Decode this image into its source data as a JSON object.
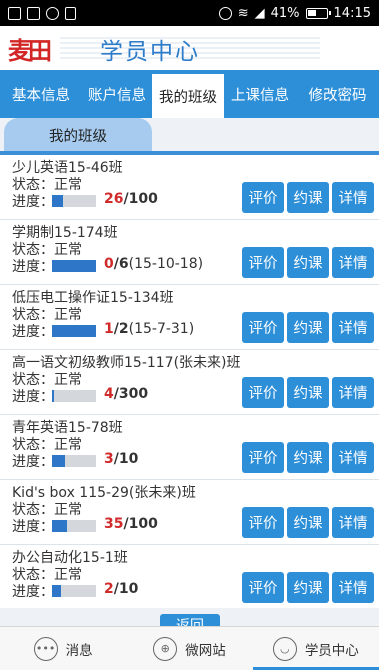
{
  "status_bar": {
    "battery": "41%",
    "time": "14:15"
  },
  "header": {
    "logo_text": "麦田",
    "title": "学员中心"
  },
  "tabs": [
    {
      "label": "基本信息"
    },
    {
      "label": "账户信息"
    },
    {
      "label": "我的班级"
    },
    {
      "label": "上课信息"
    },
    {
      "label": "修改密码"
    }
  ],
  "section": {
    "title": "我的班级"
  },
  "labels": {
    "status_prefix": "状态：",
    "progress_prefix": "进度：",
    "rate": "评价",
    "book": "约课",
    "detail": "详情"
  },
  "classes": [
    {
      "name": "少儿英语15-46班",
      "status": "正常",
      "done": "26",
      "total": "/100",
      "extra": "",
      "fraction": 0.26
    },
    {
      "name": "学期制15-174班",
      "status": "正常",
      "done": "0",
      "total": "/6",
      "extra": "(15-10-18)",
      "fraction": 1.0
    },
    {
      "name": "低压电工操作证15-134班",
      "status": "正常",
      "done": "1",
      "total": "/2",
      "extra": "(15-7-31)",
      "fraction": 1.0
    },
    {
      "name": "高一语文初级教师15-117(张未来)班",
      "status": "正常",
      "done": "4",
      "total": "/300",
      "extra": "",
      "fraction": 0.05
    },
    {
      "name": "青年英语15-78班",
      "status": "正常",
      "done": "3",
      "total": "/10",
      "extra": "",
      "fraction": 0.3
    },
    {
      "name": "Kid's box 115-29(张未来)班",
      "status": "正常",
      "done": "35",
      "total": "/100",
      "extra": "",
      "fraction": 0.35
    },
    {
      "name": "办公自动化15-1班",
      "status": "正常",
      "done": "2",
      "total": "/10",
      "extra": "",
      "fraction": 0.2
    }
  ],
  "back_button": {
    "label": "返回"
  },
  "bottom_nav": [
    {
      "label": "消息",
      "icon": "chat-icon"
    },
    {
      "label": "微网站",
      "icon": "globe-icon"
    },
    {
      "label": "学员中心",
      "icon": "user-icon"
    }
  ],
  "colors": {
    "accent": "#2d8fd8",
    "progress_done": "#d12a2a",
    "bar_fill": "#2e76c8"
  }
}
